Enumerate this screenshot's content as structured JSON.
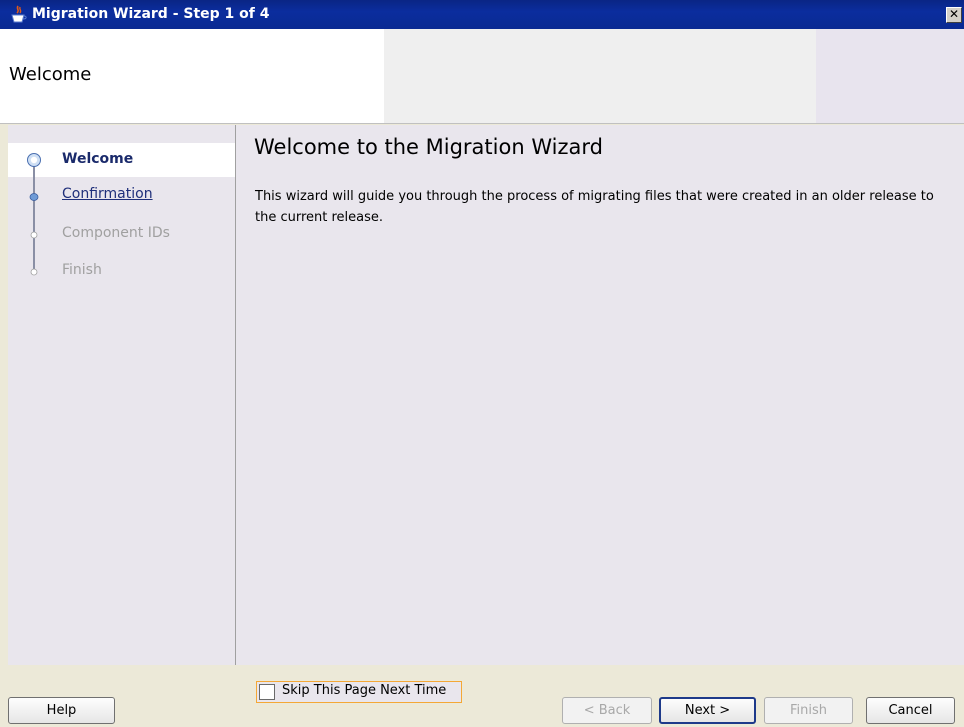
{
  "window": {
    "title": "Migration Wizard - Step 1 of 4",
    "close_glyph": "✕",
    "icon": "java-cup-icon"
  },
  "header": {
    "title": "Welcome"
  },
  "steps": [
    {
      "label": "Welcome",
      "state": "current"
    },
    {
      "label": "Confirmation",
      "state": "link"
    },
    {
      "label": "Component IDs",
      "state": "disabled"
    },
    {
      "label": "Finish",
      "state": "disabled"
    }
  ],
  "main": {
    "title": "Welcome to the Migration Wizard",
    "description": "This wizard will guide you through the process of migrating files that were created in an older release to the current release."
  },
  "skip": {
    "label": "Skip This Page Next Time",
    "checked": false
  },
  "buttons": {
    "help": "Help",
    "back": "< Back",
    "next": "Next >",
    "finish": "Finish",
    "cancel": "Cancel"
  },
  "colors": {
    "titlebar": "#0a2a92",
    "panel_bg": "#e9e6ed",
    "link": "#1f2f7a",
    "focus": "#f4a836"
  }
}
